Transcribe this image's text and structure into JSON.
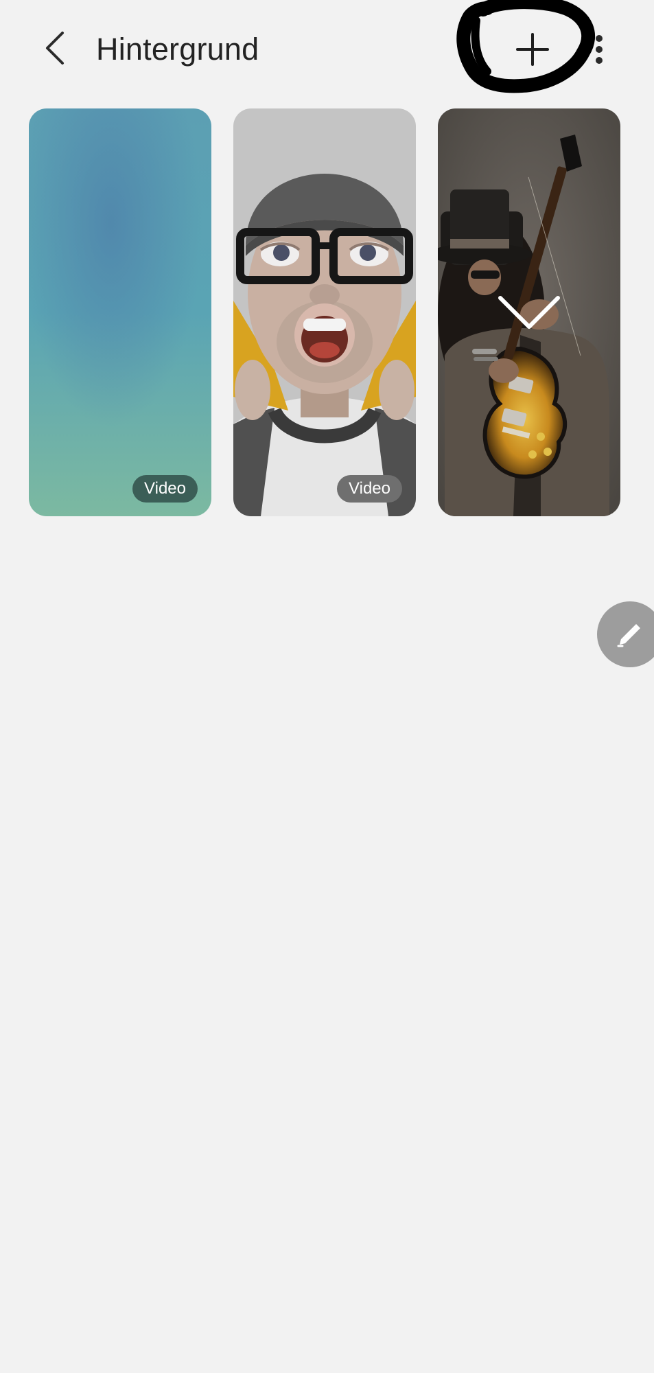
{
  "header": {
    "title": "Hintergrund",
    "back_icon": "chevron-left-icon",
    "add_icon": "plus-icon",
    "more_icon": "more-vertical-icon",
    "annotation_color": "#000000"
  },
  "wallpapers": [
    {
      "name": "Blue-green gradient",
      "badge": "Video",
      "selected": false,
      "colors": [
        "#5b8fae",
        "#5aa6b1",
        "#7cb8a0"
      ]
    },
    {
      "name": "Avatar",
      "badge": "Video",
      "selected": false
    },
    {
      "name": "Guitarist photo",
      "badge": "",
      "selected": true,
      "check_icon": "checkmark-icon"
    }
  ],
  "fab": {
    "icon": "pencil-icon",
    "color": "#9d9d9d"
  }
}
